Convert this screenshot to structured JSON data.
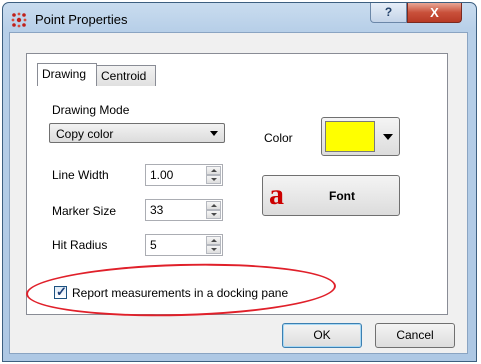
{
  "window": {
    "title": "Point Properties",
    "help_label": "?",
    "close_label": "X"
  },
  "tabs": [
    {
      "label": "Drawing",
      "active": true
    },
    {
      "label": "Centroid",
      "active": false
    }
  ],
  "drawing": {
    "mode_label": "Drawing Mode",
    "mode_value": "Copy color",
    "color_label": "Color",
    "color_value": "#ffff00",
    "line_width_label": "Line Width",
    "line_width_value": "1.00",
    "marker_size_label": "Marker Size",
    "marker_size_value": "33",
    "hit_radius_label": "Hit Radius",
    "hit_radius_value": "5",
    "font_icon_glyph": "a",
    "font_label": "Font",
    "report_checkbox_label": "Report measurements in a docking pane",
    "report_checked": true
  },
  "buttons": {
    "ok": "OK",
    "cancel": "Cancel"
  },
  "colors": {
    "annotation_ellipse": "#e0202a"
  }
}
